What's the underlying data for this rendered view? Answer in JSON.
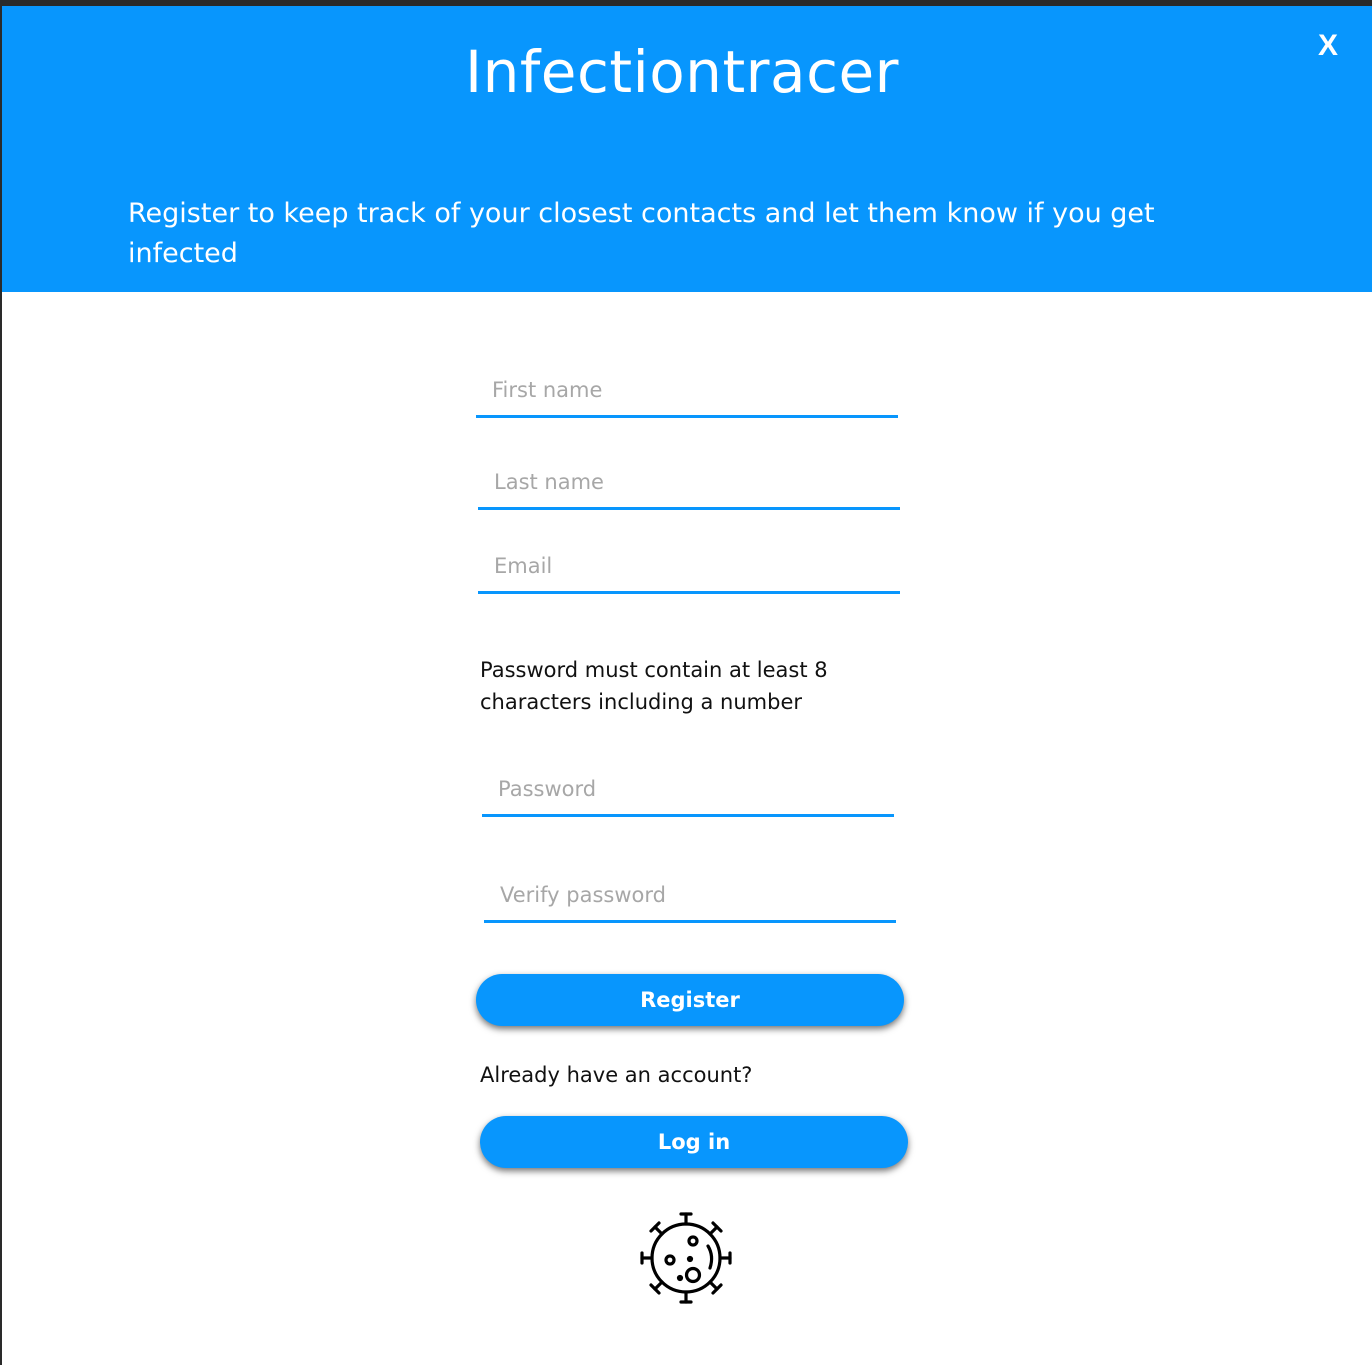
{
  "header": {
    "app_title": "Infectiontracer",
    "close_label": "X",
    "subtitle": "Register to keep track of your closest contacts and let them know if you get infected",
    "background_color": "#0896fd"
  },
  "form": {
    "first_name_placeholder": "First name",
    "last_name_placeholder": "Last name",
    "email_placeholder": "Email",
    "password_hint": "Password must contain at least 8 characters including a number",
    "password_placeholder": "Password",
    "verify_password_placeholder": "Verify password",
    "register_label": "Register",
    "already_account_text": "Already have an account?",
    "login_label": "Log in"
  },
  "logo": {
    "icon": "virus-icon"
  },
  "colors": {
    "accent": "#0896fd",
    "text": "#111111",
    "placeholder": "#a7a7a7"
  }
}
